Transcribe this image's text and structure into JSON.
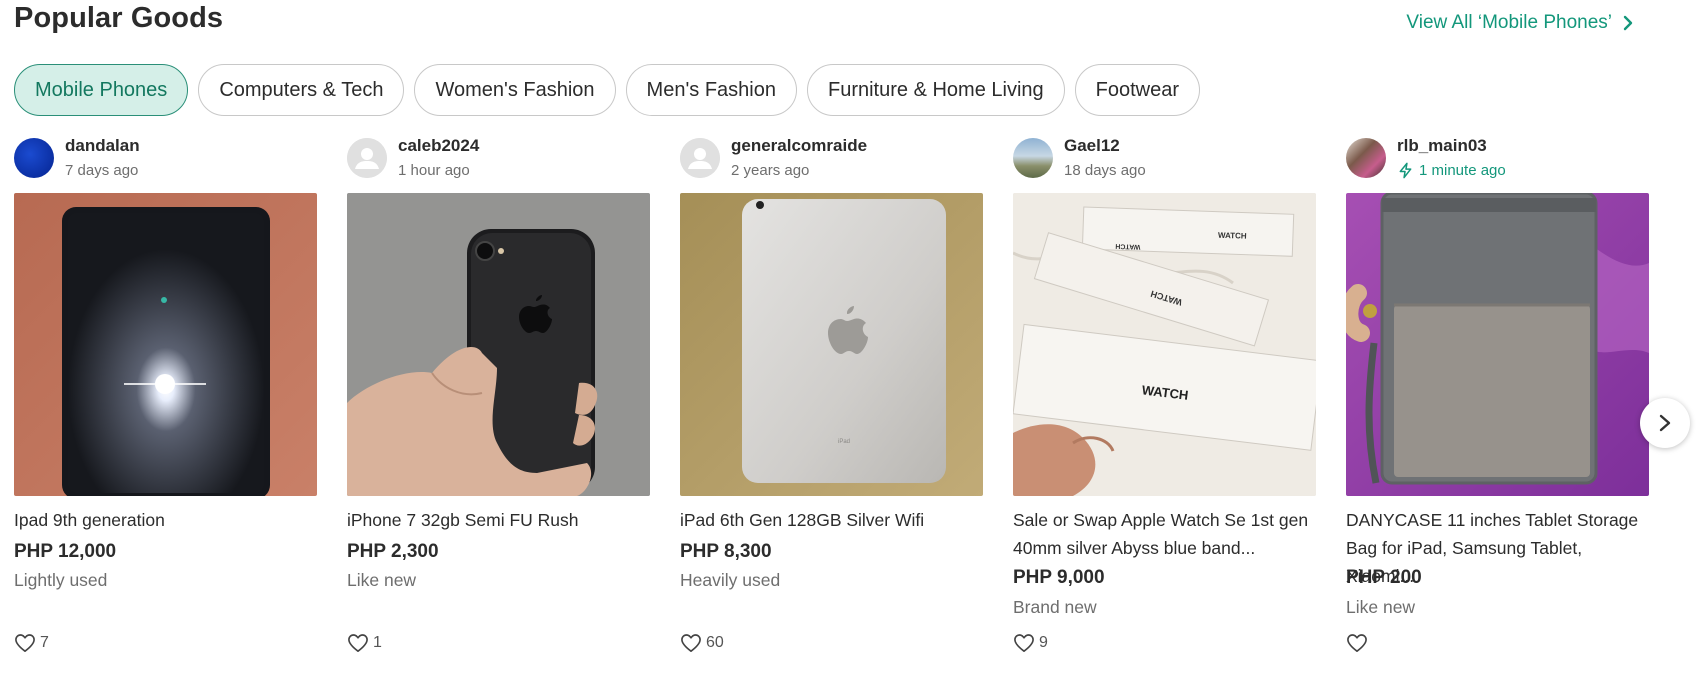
{
  "header": {
    "title": "Popular Goods",
    "view_all": "View All ‘Mobile Phones’"
  },
  "categories": [
    {
      "label": "Mobile Phones",
      "active": true
    },
    {
      "label": "Computers & Tech",
      "active": false
    },
    {
      "label": "Women's Fashion",
      "active": false
    },
    {
      "label": "Men's Fashion",
      "active": false
    },
    {
      "label": "Furniture & Home Living",
      "active": false
    },
    {
      "label": "Footwear",
      "active": false
    }
  ],
  "listings": [
    {
      "seller": "dandalan",
      "time": "7 days ago",
      "title": "Ipad 9th generation",
      "price": "PHP 12,000",
      "condition": "Lightly used",
      "likes": "7",
      "avatar": "blue-avatar",
      "photo": "ipad-screen-flash"
    },
    {
      "seller": "caleb2024",
      "time": "1 hour ago",
      "title": "iPhone 7 32gb Semi FU Rush",
      "price": "PHP 2,300",
      "condition": "Like new",
      "likes": "1",
      "avatar": "default-user-icon",
      "photo": "black-iphone-in-hand"
    },
    {
      "seller": "generalcomraide",
      "time": "2 years ago",
      "title": "iPad 6th Gen 128GB Silver Wifi",
      "price": "PHP 8,300",
      "condition": "Heavily used",
      "likes": "60",
      "avatar": "default-user-icon",
      "photo": "silver-ipad-back"
    },
    {
      "seller": "Gael12",
      "time": "18 days ago",
      "title": "Sale or Swap Apple Watch Se 1st gen 40mm silver Abyss blue band...",
      "price": "PHP 9,000",
      "condition": "Brand new",
      "likes": "9",
      "avatar": "photo-avatar",
      "photo": "apple-watch-boxes"
    },
    {
      "seller": "rlb_main03",
      "time": "1 minute ago",
      "title": "DANYCASE 11 inches Tablet Storage Bag for iPad, Samsung Tablet, Xiaomi...",
      "price": "PHP 200",
      "condition": "Like new",
      "likes": "",
      "avatar": "photo-avatar",
      "photo": "grey-tablet-bag",
      "time_icon": "lightning-icon"
    }
  ],
  "colors": {
    "accent": "#13977b",
    "chip_active_bg": "#d5efe8",
    "text": "#2c2c2c",
    "muted": "#6e6e6e"
  },
  "icons": {
    "view_all": "chevron-right-icon",
    "like": "heart-outline-icon",
    "next": "chevron-right-icon"
  }
}
